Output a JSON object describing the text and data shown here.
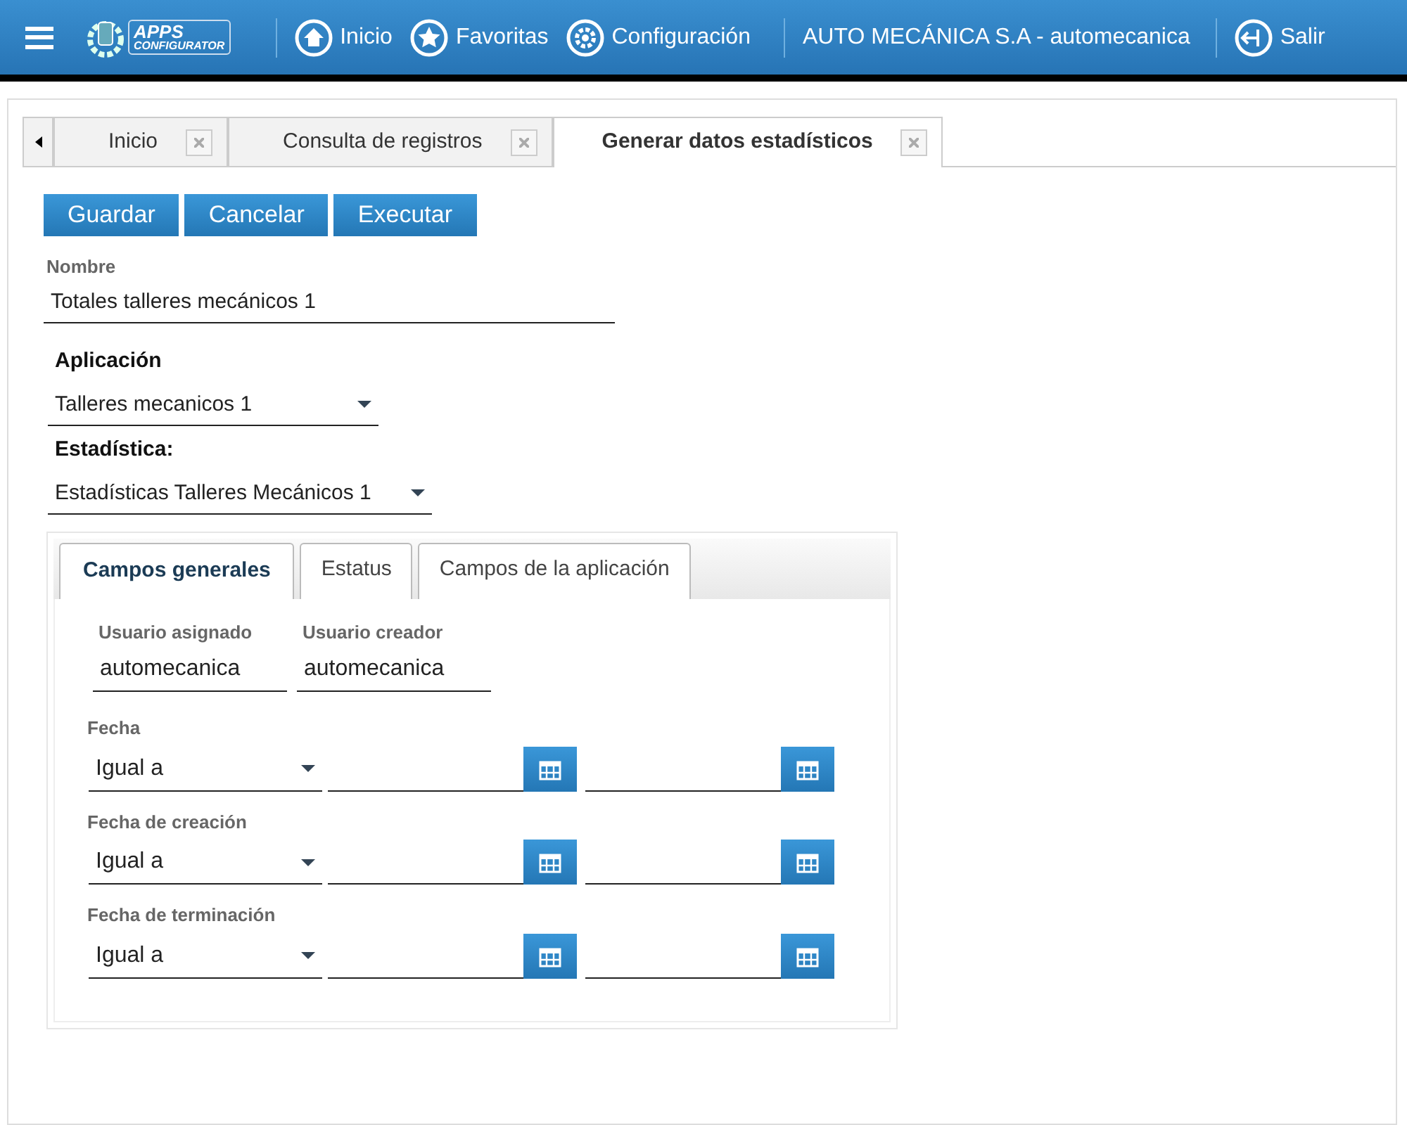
{
  "header": {
    "logo": {
      "line1": "APPS",
      "line2": "CONFIGURATOR"
    },
    "nav": [
      {
        "kind": "home",
        "label": "Inicio"
      },
      {
        "kind": "star",
        "label": "Favoritas"
      },
      {
        "kind": "gear",
        "label": "Configuración"
      }
    ],
    "company": "AUTO MECÁNICA S.A - automecanica",
    "logout": "Salir"
  },
  "tabs": [
    {
      "label": "Inicio",
      "selected": false
    },
    {
      "label": "Consulta de registros",
      "selected": false
    },
    {
      "label": "Generar datos estadísticos",
      "selected": true
    }
  ],
  "buttons": [
    "Guardar",
    "Cancelar",
    "Executar"
  ],
  "name_field": {
    "label": "Nombre",
    "value": "Totales talleres mecánicos 1"
  },
  "application": {
    "label": "Aplicación",
    "value": "Talleres mecanicos 1"
  },
  "statistic": {
    "label": "Estadística:",
    "value": "Estadísticas Talleres Mecánicos 1"
  },
  "subtabs": [
    {
      "label": "Campos generales",
      "selected": true
    },
    {
      "label": "Estatus",
      "selected": false
    },
    {
      "label": "Campos de la aplicación",
      "selected": false
    }
  ],
  "users": [
    {
      "label": "Usuario asignado",
      "value": "automecanica"
    },
    {
      "label": "Usuario creador",
      "value": "automecanica"
    }
  ],
  "date_filters": [
    {
      "label": "Fecha",
      "operator": "Igual a"
    },
    {
      "label": "Fecha de creación",
      "operator": "Igual a"
    },
    {
      "label": "Fecha de terminación",
      "operator": "Igual a"
    }
  ]
}
